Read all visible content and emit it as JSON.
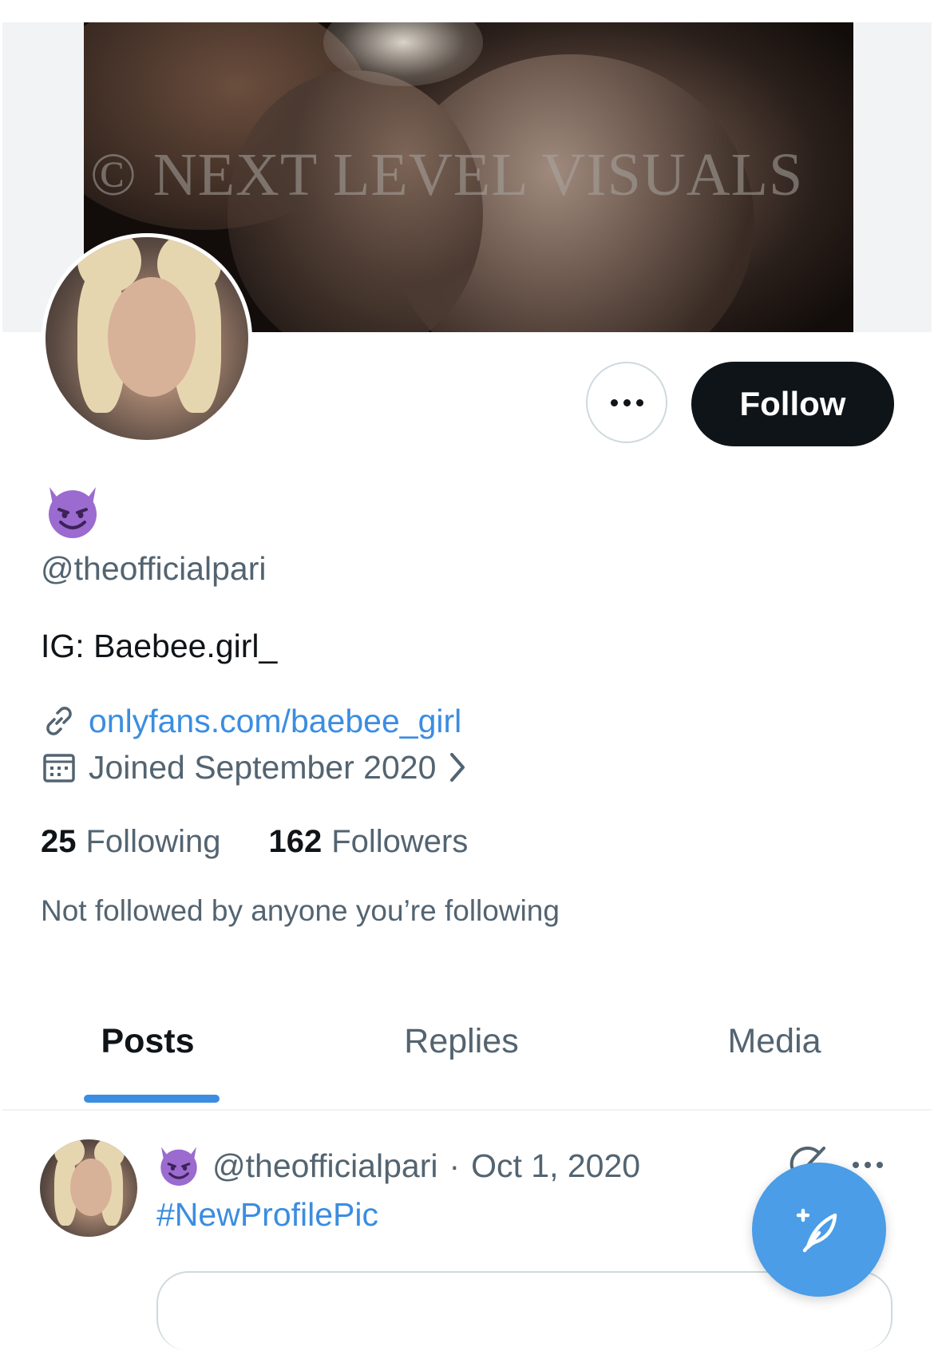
{
  "banner": {
    "watermark": "© NEXT LEVEL VISUALS"
  },
  "actions": {
    "follow_label": "Follow"
  },
  "profile": {
    "display_name_icon": "smiling-devil-emoji",
    "handle": "@theofficialpari",
    "bio": "IG: Baebee.girl_",
    "link": "onlyfans.com/baebee_girl",
    "joined": "Joined September 2020",
    "following_count": "25",
    "following_label": "Following",
    "followers_count": "162",
    "followers_label": "Followers",
    "not_followed_text": "Not followed by anyone you’re following"
  },
  "tabs": [
    {
      "label": "Posts",
      "active": true
    },
    {
      "label": "Replies",
      "active": false
    },
    {
      "label": "Media",
      "active": false
    }
  ],
  "post": {
    "handle": "@theofficialpari",
    "separator": "·",
    "date": "Oct 1, 2020",
    "text": "#NewProfilePic"
  },
  "icons": {
    "link": "link-icon",
    "calendar": "calendar-icon",
    "chevron": "chevron-right-icon",
    "more": "more-icon",
    "compose": "compose-icon",
    "grok": "grok-icon"
  },
  "colors": {
    "accent": "#3b8de0",
    "text_primary": "#0f1419",
    "text_secondary": "#536471",
    "follow_bg": "#0f1419",
    "emoji_purple": "#9b6bd0"
  }
}
